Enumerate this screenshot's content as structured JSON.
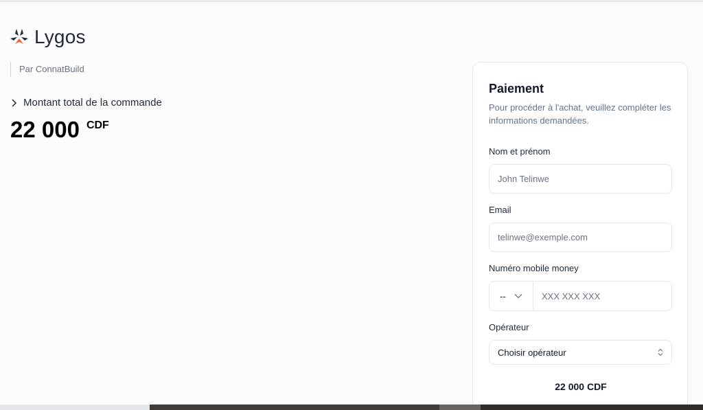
{
  "brand": {
    "name": "Lygos",
    "merchant": "Par ConnatBuild",
    "accent": "#e8652b"
  },
  "summary": {
    "toggle_label": "Montant total de la commande",
    "amount": "22 000",
    "currency": "CDF"
  },
  "payment": {
    "title": "Paiement",
    "description": "Pour procéder à l'achat, veuillez compléter les informations demandées.",
    "name_label": "Nom et prénom",
    "name_placeholder": "John Telinwe",
    "email_label": "Email",
    "email_placeholder": "telinwe@exemple.com",
    "phone_label": "Numéro mobile money",
    "phone_prefix": "--",
    "phone_placeholder": "XXX XXX XXX",
    "operator_label": "Opérateur",
    "operator_value": "Choisir opérateur",
    "total": "22 000 CDF"
  },
  "icons": {
    "logo": "lygos-logo-icon",
    "toggle": "chevron-right-icon",
    "prefix": "chevron-down-icon",
    "operator": "chevron-up-down-icon"
  }
}
